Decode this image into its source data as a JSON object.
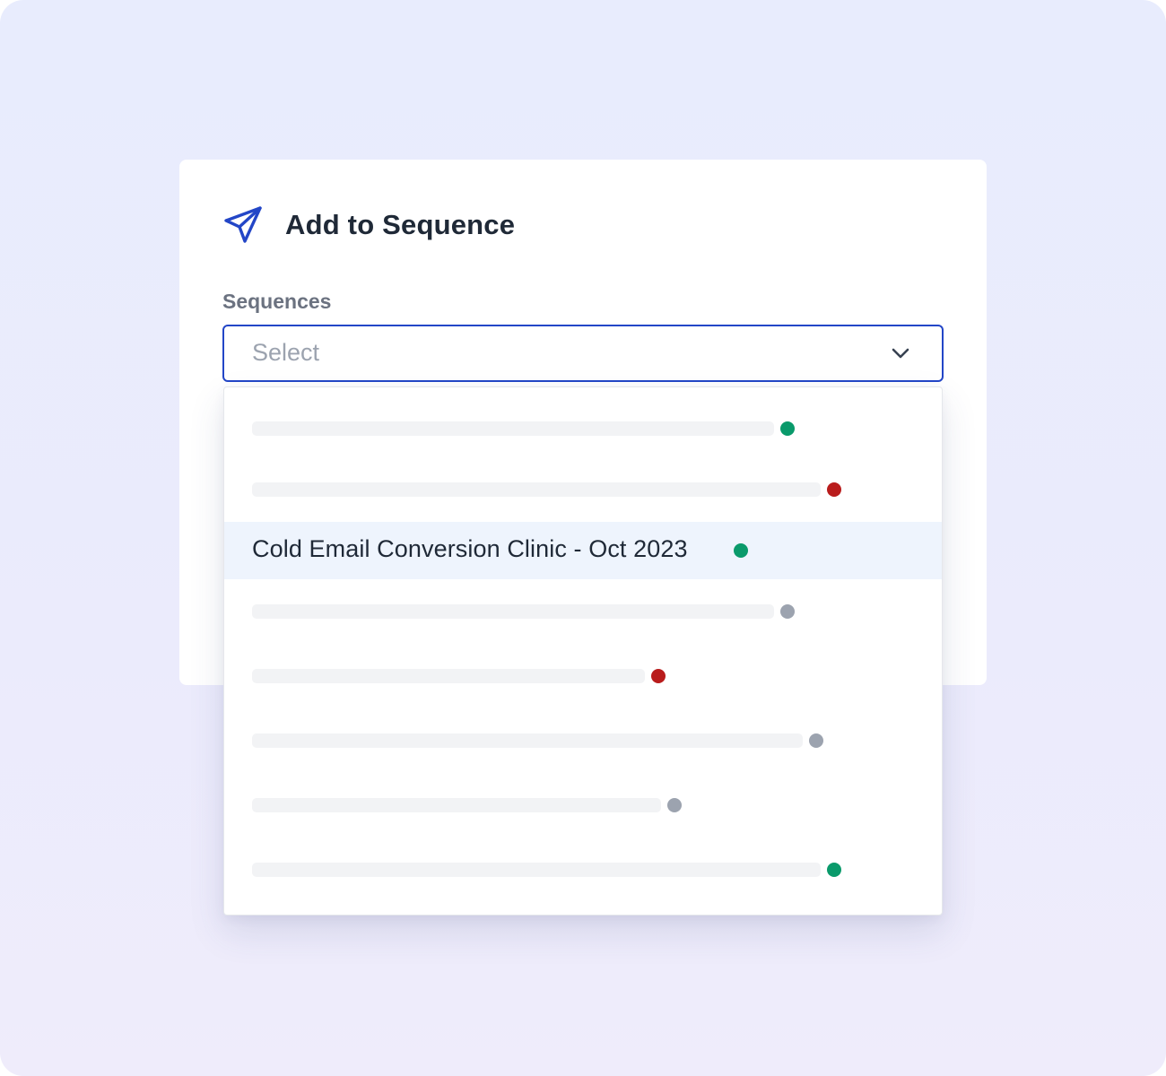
{
  "modal": {
    "title": "Add to Sequence",
    "icon": "paper-plane-icon",
    "accent_color": "#2346c7"
  },
  "field": {
    "label": "Sequences",
    "placeholder": "Select",
    "icon": "chevron-down-icon"
  },
  "status_colors": {
    "active": "#0a9a6b",
    "error": "#b91c1c",
    "inactive": "#9ca3af"
  },
  "dropdown": {
    "selected_option": {
      "label": "Cold Email Conversion Clinic - Oct 2023",
      "status": "active"
    },
    "options": [
      {
        "status": "active"
      },
      {
        "status": "error"
      },
      {
        "status": "active",
        "label": "Cold Email Conversion Clinic - Oct 2023"
      },
      {
        "status": "inactive"
      },
      {
        "status": "error"
      },
      {
        "status": "inactive"
      },
      {
        "status": "inactive"
      },
      {
        "status": "active"
      }
    ]
  }
}
